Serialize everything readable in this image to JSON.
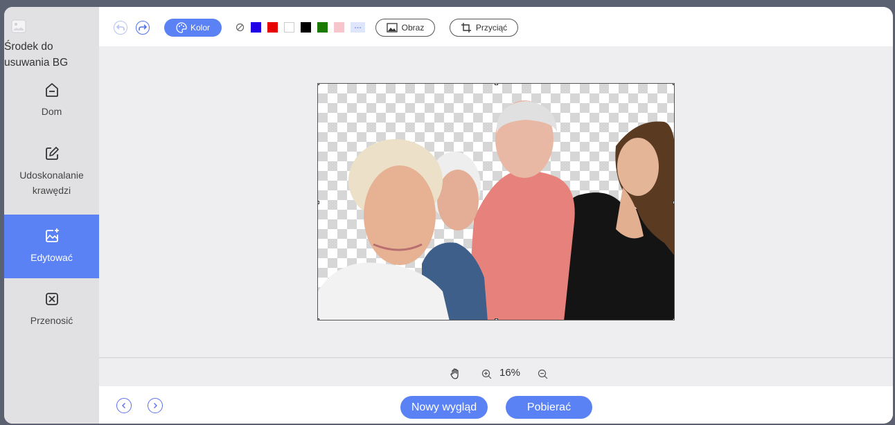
{
  "sidebar": {
    "app_title": "Środek do usuwania BG",
    "logo_icon": "photo-cloud-icon",
    "items": [
      {
        "label": "Dom",
        "icon": "home-icon",
        "active": false
      },
      {
        "label": "Udoskonalanie krawędzi",
        "icon": "edit-square-icon",
        "active": false
      },
      {
        "label": "Edytować",
        "icon": "image-edit-icon",
        "active": true
      },
      {
        "label": "Przenosić",
        "icon": "move-arrows-icon",
        "active": false
      }
    ]
  },
  "toolbar": {
    "undo_icon": "undo-icon",
    "redo_icon": "redo-icon",
    "color_button_label": "Kolor",
    "swatches": [
      "none",
      "#1f00e6",
      "#e60000",
      "#ffffff",
      "#000000",
      "#1a7a00",
      "#f7c5cc",
      "more"
    ],
    "image_button_label": "Obraz",
    "crop_button_label": "Przyciąć"
  },
  "zoom": {
    "percent": "16%"
  },
  "footer": {
    "new_look_label": "Nowy wygląd",
    "download_label": "Pobierać"
  },
  "colors": {
    "accent": "#5b82f4",
    "sidebar_bg": "#e1e1e3",
    "canvas_bg": "#eeeef0"
  }
}
